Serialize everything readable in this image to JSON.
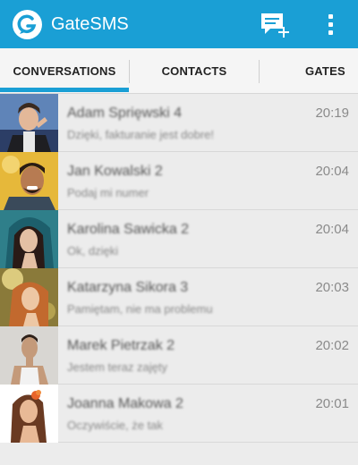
{
  "app": {
    "title": "GateSMS",
    "accent": "#1a9fd5",
    "logo_icon": "gatesms-logo-icon"
  },
  "actions": {
    "new_message_icon": "new-message-icon",
    "overflow_icon": "overflow-menu-icon"
  },
  "tabs": [
    {
      "label": "CONVERSATIONS",
      "selected": true
    },
    {
      "label": "CONTACTS",
      "selected": false
    },
    {
      "label": "GATES",
      "selected": false
    }
  ],
  "conversations": [
    {
      "name": "Adam Sprięwski 4",
      "preview": "Dzięki, fakturanie jest dobre!",
      "time": "20:19"
    },
    {
      "name": "Jan Kowalski 2",
      "preview": "Podaj mi numer",
      "time": "20:04"
    },
    {
      "name": "Karolina Sawicka 2",
      "preview": "Ok, dzięki",
      "time": "20:04"
    },
    {
      "name": "Katarzyna Sikora 3",
      "preview": "Pamiętam, nie ma problemu",
      "time": "20:03"
    },
    {
      "name": "Marek Pietrzak 2",
      "preview": "Jestem teraz zajęty",
      "time": "20:02"
    },
    {
      "name": "Joanna Makowa 2",
      "preview": "Oczywiście, że tak",
      "time": "20:01"
    }
  ]
}
